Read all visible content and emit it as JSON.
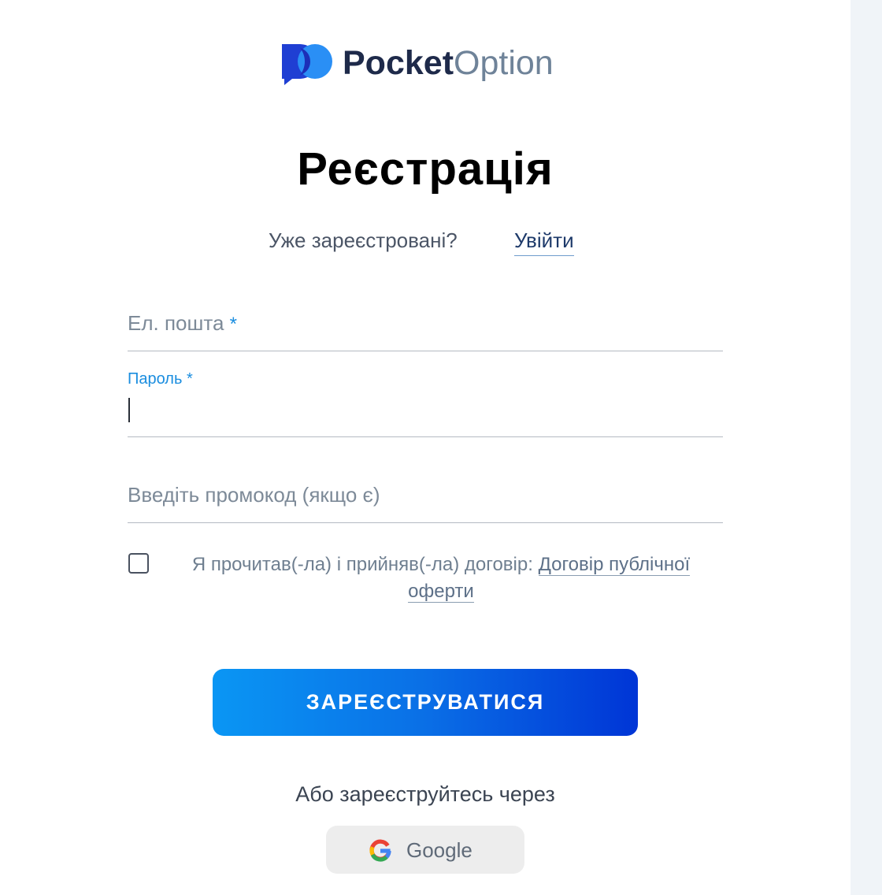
{
  "brand": {
    "name_bold": "Pocket",
    "name_light": "Option",
    "logo_colors": [
      "#1f3fd3",
      "#2a8ff5"
    ]
  },
  "page": {
    "title": "Реєстрація"
  },
  "login_prompt": {
    "text": "Уже зареєстровані?",
    "link_label": "Увійти"
  },
  "form": {
    "email": {
      "label": "Ел. пошта",
      "required_mark": "*",
      "value": ""
    },
    "password": {
      "label": "Пароль",
      "required_mark": "*",
      "value": "",
      "focused": true
    },
    "promo": {
      "placeholder": "Введіть промокод (якщо є)",
      "value": ""
    },
    "agreement": {
      "checked": false,
      "text": "Я прочитав(-ла) і прийняв(-ла) договір:",
      "link_label": "Договір публічної оферти"
    },
    "submit_label": "ЗАРЕЄСТРУВАТИСЯ"
  },
  "social": {
    "prompt": "Або зареєструйтесь через",
    "google_label": "Google",
    "google_icon": "google-icon"
  },
  "colors": {
    "accent": "#1a8ddf",
    "button_gradient_start": "#0a96f4",
    "button_gradient_end": "#0035d6",
    "side_panel": "#f0f4f8"
  }
}
